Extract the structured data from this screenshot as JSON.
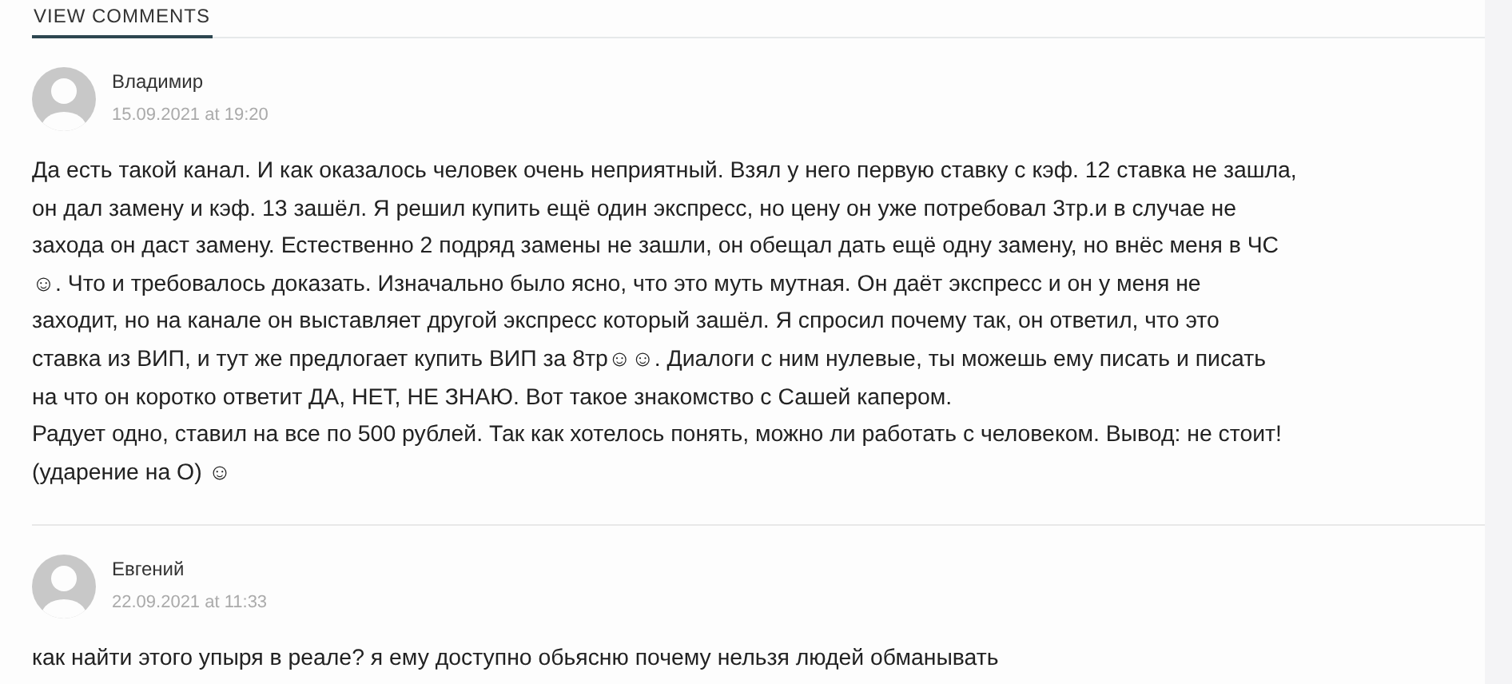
{
  "tabs": [
    {
      "label": "VIEW COMMENTS",
      "selected": true
    }
  ],
  "comments": [
    {
      "author": "Владимир",
      "date": "15.09.2021 at 19:20",
      "lines": [
        "Да есть такой канал. И как оказалось человек очень неприятный. Взял у него первую ставку с кэф. 12 ставка не зашла,",
        "он дал замену и кэф. 13 зашёл. Я решил купить ещё один экспресс, но цену он уже потребовал 3тр.и в случае не",
        "захода он даст замену. Естественно 2 подряд замены не зашли, он обещал дать ещё одну замену, но внёс меня в ЧС",
        "☺. Что и требовалось доказать. Изначально было ясно, что это муть мутная. Он даёт экспресс и он у меня не",
        "заходит, но на канале он выставляет другой экспресс который зашёл. Я спросил почему так, он ответил, что это",
        "ставка из ВИП, и тут же предлогает купить ВИП за 8тр☺☺. Диалоги с ним нулевые, ты можешь ему писать и писать",
        "на что он коротко ответит ДА, НЕТ, НЕ ЗНАЮ. Вот такое знакомство с Сашей капером.",
        "Радует одно, ставил на все по 500 рублей. Так как хотелось понять, можно ли работать с человеком. Вывод: не стоит!",
        "(ударение на О) ☺"
      ]
    },
    {
      "author": "Евгений",
      "date": "22.09.2021 at 11:33",
      "lines": [
        "как найти этого упыря в реале? я ему доступно обьясню почему нельзя людей обманывать"
      ]
    }
  ]
}
